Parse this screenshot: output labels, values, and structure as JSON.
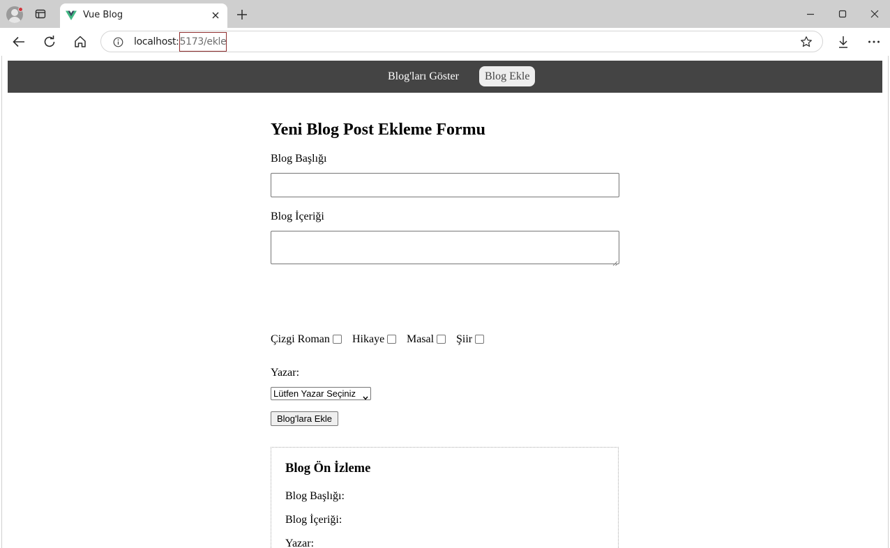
{
  "browser": {
    "tab": {
      "title": "Vue Blog"
    },
    "address": {
      "host": "localhost:",
      "path": "5173/ekle"
    }
  },
  "nav": {
    "items": [
      {
        "label": "Blog'ları Göster",
        "active": false
      },
      {
        "label": "Blog Ekle",
        "active": true
      }
    ]
  },
  "form": {
    "title": "Yeni Blog Post Ekleme Formu",
    "title_label": "Blog Başlığı",
    "title_value": "",
    "content_label": "Blog İçeriği",
    "content_value": "",
    "categories": [
      {
        "label": "Çizgi Roman",
        "checked": false
      },
      {
        "label": "Hikaye",
        "checked": false
      },
      {
        "label": "Masal",
        "checked": false
      },
      {
        "label": "Şiir",
        "checked": false
      }
    ],
    "author_label": "Yazar:",
    "author_select": "Lütfen Yazar Seçiniz",
    "submit_label": "Blog'lara Ekle"
  },
  "preview": {
    "title": "Blog Ön İzleme",
    "title_line": "Blog Başlığı:",
    "content_line": "Blog İçeriği:",
    "author_line": "Yazar:"
  },
  "colors": {
    "nav_bg": "#444444",
    "nav_active_bg": "#eeeeee",
    "vue_green": "#42b883",
    "vue_dark": "#35495e"
  },
  "icons": [
    "profile-icon",
    "workspaces-icon",
    "vue-logo-icon",
    "close-icon",
    "plus-icon",
    "minimize-icon",
    "maximize-icon",
    "close-window-icon",
    "back-icon",
    "reload-icon",
    "home-icon",
    "info-icon",
    "favorite-star-icon",
    "download-icon",
    "more-icon"
  ]
}
